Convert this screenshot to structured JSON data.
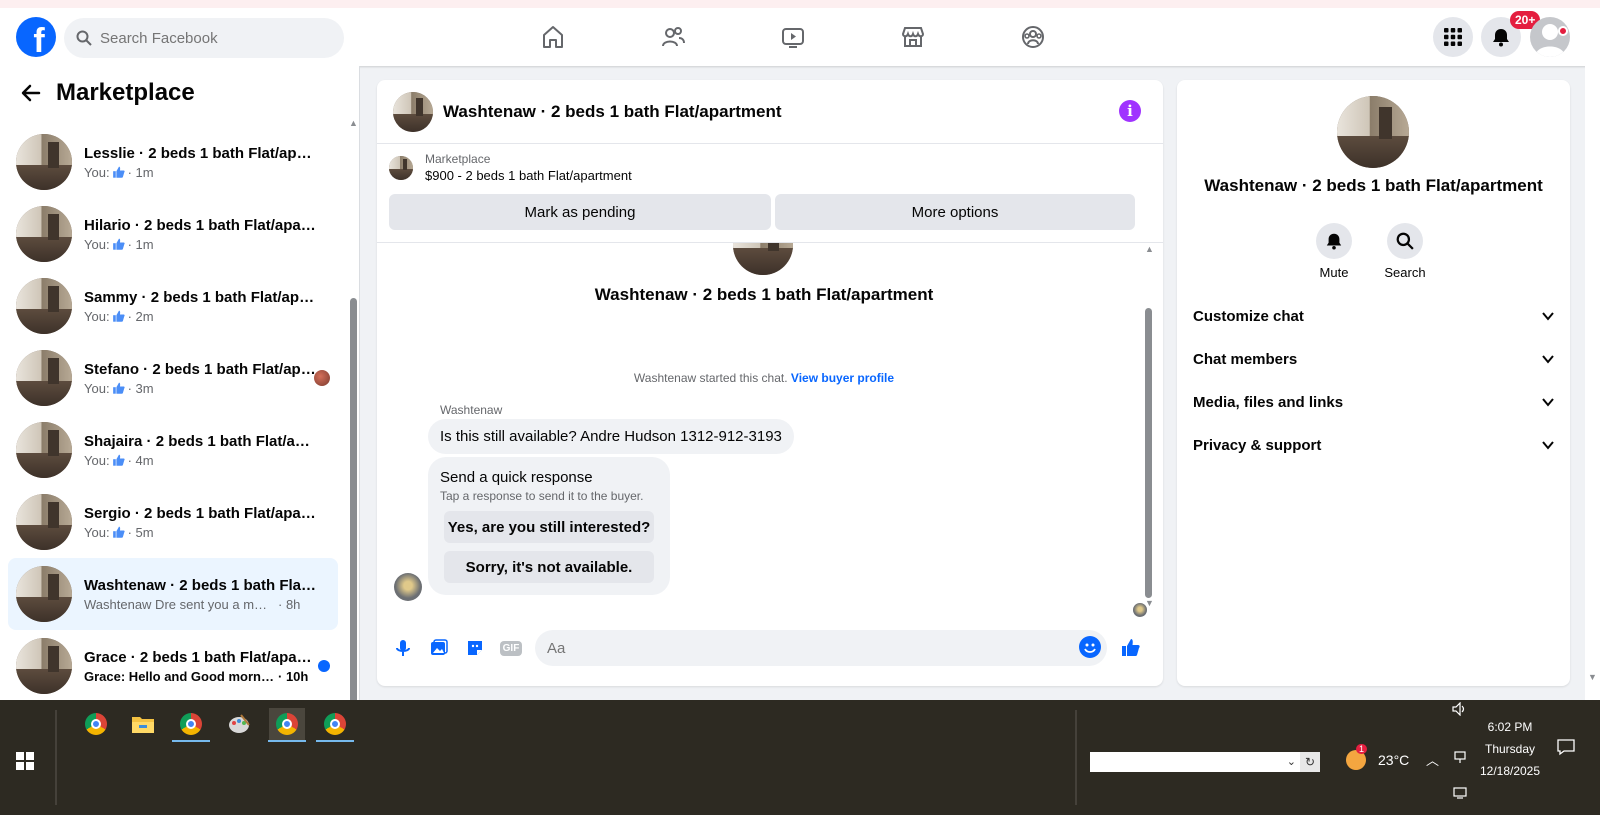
{
  "topbar": {
    "logo_letter": "f",
    "search_placeholder": "Search Facebook",
    "notification_count": "20+",
    "nav_icons": [
      "home-icon",
      "friends-icon",
      "video-icon",
      "marketplace-icon",
      "groups-icon"
    ]
  },
  "sidebar": {
    "title": "Marketplace",
    "conversations": [
      {
        "name": "Lesslie · 2 beds 1 bath Flat/apartment",
        "prefix": "You:",
        "time": "· 1m",
        "active": false,
        "unread": false
      },
      {
        "name": "Hilario · 2 beds 1 bath Flat/apartment",
        "prefix": "You:",
        "time": "· 1m",
        "active": false,
        "unread": false
      },
      {
        "name": "Sammy · 2 beds 1 bath Flat/apartment",
        "prefix": "You:",
        "time": "· 2m",
        "active": false,
        "unread": false
      },
      {
        "name": "Stefano · 2 beds 1 bath Flat/apartment",
        "prefix": "You:",
        "time": "· 3m",
        "active": false,
        "unread": false
      },
      {
        "name": "Shajaira · 2 beds 1 bath Flat/apartment",
        "prefix": "You:",
        "time": "· 4m",
        "active": false,
        "unread": false
      },
      {
        "name": "Sergio · 2 beds 1 bath Flat/apartment",
        "prefix": "You:",
        "time": "· 5m",
        "active": false,
        "unread": false
      },
      {
        "name": "Washtenaw · 2 beds 1 bath Flat/apartment",
        "prefix": "Washtenaw Dre sent you a messag...",
        "time": "· 8h",
        "active": true,
        "unread": false
      },
      {
        "name": "Grace · 2 beds 1 bath Flat/apartment",
        "prefix": "Grace: Hello and Good mornin...",
        "time": "· 10h",
        "active": false,
        "unread": true
      }
    ]
  },
  "chat": {
    "title": "Washtenaw · 2 beds 1 bath Flat/apartment",
    "marketplace_label": "Marketplace",
    "listing_price": "$900 - 2 beds 1 bath Flat/apartment",
    "mark_pending": "Mark as pending",
    "more_options": "More options",
    "listing_title": "Washtenaw · 2 beds 1 bath Flat/apartment",
    "started_text": "Washtenaw started this chat.",
    "view_profile": "View buyer profile",
    "sender": "Washtenaw",
    "message": "Is this still available? Andre Hudson 1312-912-3193",
    "quick_title": "Send a quick response",
    "quick_sub": "Tap a response to send it to the buyer.",
    "quick_options": [
      "Yes, are you still interested?",
      "Sorry, it's not available."
    ],
    "composer_placeholder": "Aa",
    "gif_label": "GIF"
  },
  "details": {
    "title": "Washtenaw · 2 beds 1 bath Flat/apartment",
    "mute": "Mute",
    "search": "Search",
    "sections": [
      "Customize chat",
      "Chat members",
      "Media, files and links",
      "Privacy & support"
    ]
  },
  "taskbar": {
    "temperature": "23°C",
    "weather_badge": "1",
    "time": "6:02 PM",
    "day": "Thursday",
    "date": "12/18/2025"
  },
  "colors": {
    "brand": "#0866ff",
    "active_row": "#ebf5ff",
    "info": "#a033ff",
    "badge": "#e41e3f"
  }
}
